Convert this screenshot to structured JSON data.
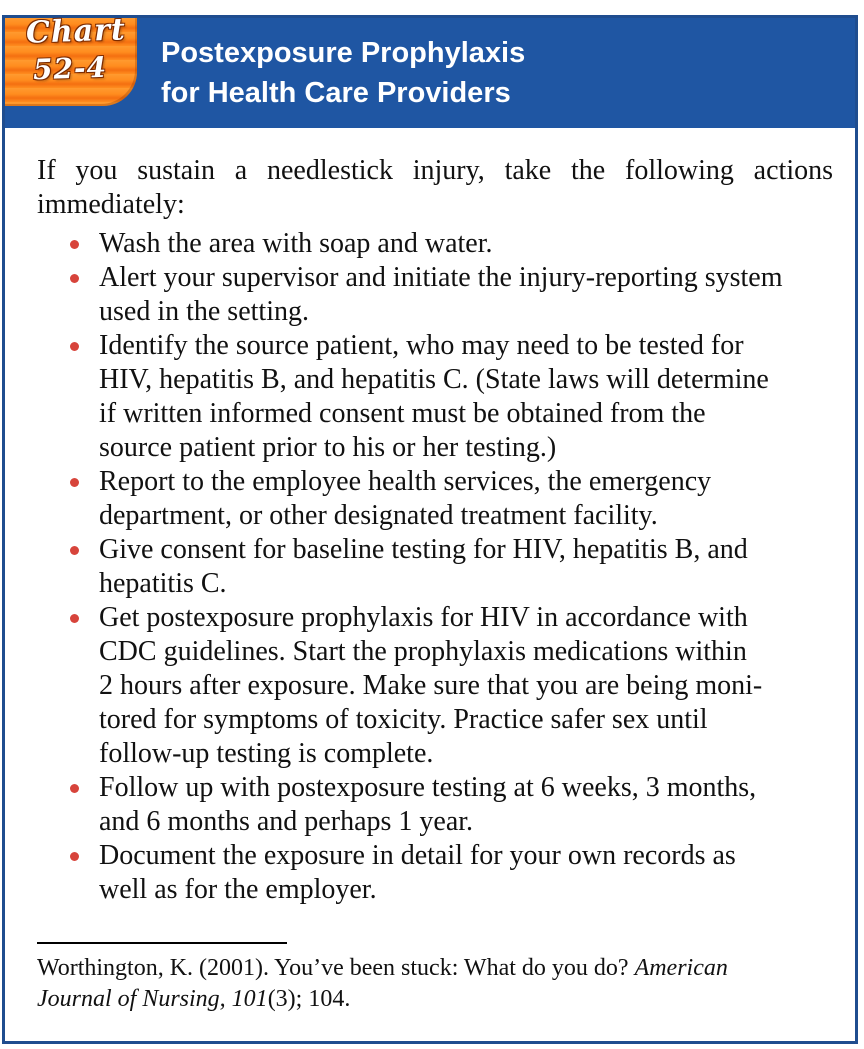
{
  "chart_tag": {
    "word": "Chart",
    "number": "52-4"
  },
  "header": {
    "title_line_1": "Postexposure Prophylaxis",
    "title_line_2": "for Health Care Providers"
  },
  "intro": "If you sustain a needlestick injury, take the following actions immediately:",
  "bullets": [
    "Wash the area with soap and water.",
    "Alert your supervisor and initiate the injury-reporting system\nused in the setting.",
    "Identify the source patient, who may need to be tested for\nHIV, hepatitis B, and hepatitis C. (State laws will determine\nif written informed consent must be obtained from the\nsource patient prior to his or her testing.)",
    "Report to the employee health services, the emergency\ndepartment, or other designated treatment facility.",
    "Give consent for baseline testing for HIV, hepatitis B, and\nhepatitis C.",
    "Get postexposure prophylaxis for HIV in accordance with\nCDC guidelines. Start the prophylaxis medications within\n2 hours after exposure. Make sure that you are being moni-\ntored for symptoms of toxicity. Practice safer sex until\nfollow-up testing is complete.",
    "Follow up with postexposure testing at 6 weeks, 3 months,\nand 6 months and perhaps 1 year.",
    "Document the exposure in detail for your own records as\nwell as for the employer."
  ],
  "reference": {
    "line1_plain": "Worthington, K. (2001). You’ve been stuck: What do you do? ",
    "line1_italic": "American",
    "line2_italic_1": "Journal of Nursing, 101",
    "line2_plain": "(3); 104."
  },
  "colors": {
    "header_blue": "#1f56a3",
    "tab_orange": "#ff8d1f",
    "bullet_red": "#d7443b"
  }
}
